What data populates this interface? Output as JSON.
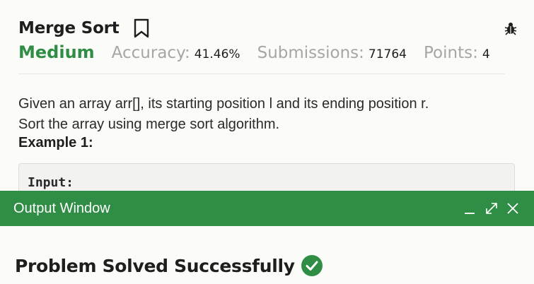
{
  "problem": {
    "title": "Merge Sort",
    "difficulty": "Medium",
    "accuracy_label": "Accuracy:",
    "accuracy_value": "41.46%",
    "submissions_label": "Submissions:",
    "submissions_value": "71764",
    "points_label": "Points:",
    "points_value": "4",
    "description_line1": "Given an array arr[], its starting position l and its ending position r.",
    "description_line2": "Sort the array using merge sort algorithm.",
    "example_heading": "Example 1:",
    "example_input_label": "Input:"
  },
  "icons": {
    "bookmark": "bookmark-icon",
    "report": "bug-icon",
    "minimize": "minimize-icon",
    "maximize": "maximize-icon",
    "close": "close-icon",
    "success": "check-circle-icon"
  },
  "output_window": {
    "title": "Output Window",
    "message": "Problem Solved Successfully"
  },
  "colors": {
    "brand_green": "#2f8d46",
    "muted_gray": "#a6a6a6",
    "text": "#1e1e1e",
    "page_bg": "#fbfbf7"
  }
}
